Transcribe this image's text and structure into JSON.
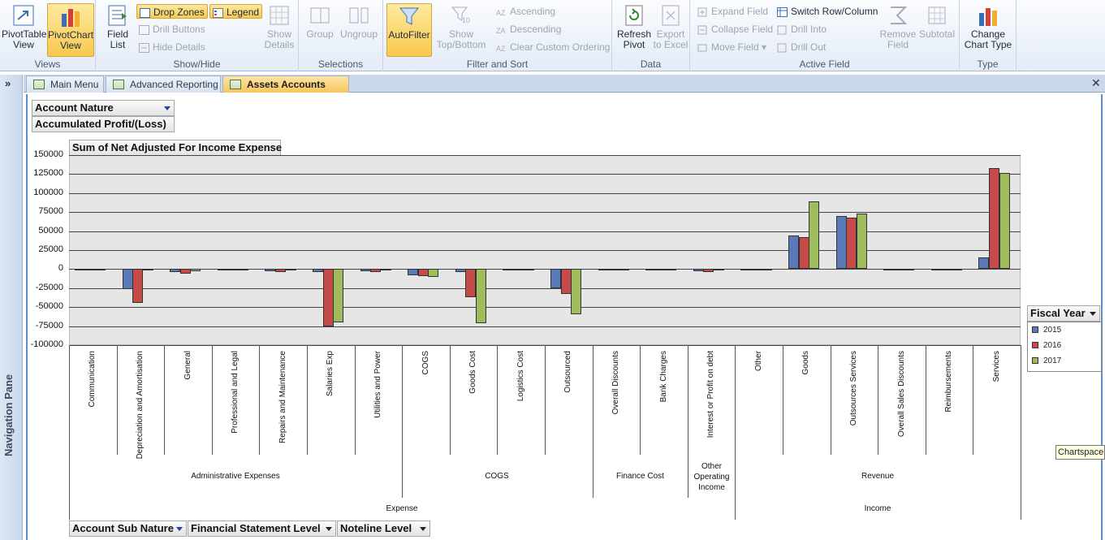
{
  "ribbon": {
    "views": {
      "label": "Views",
      "pivottable": "PivotTable View",
      "pivotchart": "PivotChart View"
    },
    "showhide": {
      "label": "Show/Hide",
      "fieldlist": "Field List",
      "dropzones": "Drop Zones",
      "legend": "Legend",
      "drillbuttons": "Drill Buttons",
      "hidedetails": "Hide Details",
      "showdetails": "Show Details"
    },
    "selections": {
      "label": "Selections",
      "group": "Group",
      "ungroup": "Ungroup"
    },
    "filtersort": {
      "label": "Filter and Sort",
      "autofilter": "AutoFilter",
      "showtopbottom": "Show Top/Bottom",
      "ascending": "Ascending",
      "descending": "Descending",
      "clearordering": "Clear Custom Ordering"
    },
    "data": {
      "label": "Data",
      "refresh": "Refresh Pivot",
      "export": "Export to Excel"
    },
    "activefield": {
      "label": "Active Field",
      "expand": "Expand Field",
      "collapse": "Collapse Field",
      "movefield": "Move Field",
      "switchrow": "Switch Row/Column",
      "drillinto": "Drill Into",
      "drillout": "Drill Out",
      "removefield": "Remove Field",
      "subtotal": "Subtotal"
    },
    "type": {
      "label": "Type",
      "changechart": "Change Chart Type"
    }
  },
  "nav": {
    "pane_label": "Navigation Pane",
    "collapse_glyph": "»",
    "close_glyph": "✕"
  },
  "tabs": [
    {
      "label": "Main Menu"
    },
    {
      "label": "Advanced Reporting"
    },
    {
      "label": "Assets Accounts Graph"
    }
  ],
  "filters": {
    "account_nature": "Account Nature",
    "accumulated": "Accumulated Profit/(Loss)",
    "data_field": "Sum of Net Adjusted For Income Expense",
    "account_sub_nature": "Account Sub Nature",
    "fs_level": "Financial Statement Level",
    "noteline_level": "Noteline Level"
  },
  "legend": {
    "title": "Fiscal Year"
  },
  "tooltip": "Chartspace",
  "colors": {
    "s2015": "#5a79b7",
    "s2016": "#c54b48",
    "s2017": "#9dbd5c"
  },
  "chart_data": {
    "type": "bar",
    "ylim": [
      -100000,
      150000
    ],
    "yticks": [
      "150000",
      "125000",
      "100000",
      "75000",
      "50000",
      "25000",
      "0",
      "-25000",
      "-50000",
      "-75000",
      "-100000"
    ],
    "categories": [
      "Communication",
      "Depreciation and Amortisation",
      "General",
      "Professional and Legal",
      "Repairs and Maintenance",
      "Salaries Exp",
      "Utilities and Power",
      "COGS",
      "Goods Cost",
      "Logistics Cost",
      "Outsourced",
      "Overall Discounts",
      "Bank Charges",
      "Interest or Profit on debt",
      "Other",
      "Goods",
      "Outsources Services",
      "Overall Sales Discounts",
      "Reimbursements",
      "Services"
    ],
    "groups": [
      {
        "label": "Administrative Expenses",
        "count": 7
      },
      {
        "label": "COGS",
        "count": 4
      },
      {
        "label": "Finance Cost",
        "count": 2
      },
      {
        "label": "Other Operating Income",
        "count": 1
      },
      {
        "label": "Revenue",
        "count": 6
      }
    ],
    "top_groups": [
      {
        "label": "Expense",
        "count": 14
      },
      {
        "label": "Income",
        "count": 6
      }
    ],
    "series": [
      {
        "name": "2015",
        "values": [
          -1000,
          -26000,
          -4000,
          -1000,
          -3000,
          -4000,
          -3000,
          -8000,
          -4000,
          0,
          -25000,
          0,
          0,
          -3000,
          0,
          44000,
          70000,
          0,
          1000,
          15000
        ]
      },
      {
        "name": "2016",
        "values": [
          -1000,
          -45000,
          -6000,
          -1000,
          -4000,
          -76000,
          -4000,
          -9000,
          -37000,
          -1000,
          -33000,
          0,
          -1000,
          -4000,
          0,
          42000,
          68000,
          0,
          1000,
          133000
        ]
      },
      {
        "name": "2017",
        "values": [
          -1000,
          0,
          -3000,
          -1000,
          -2000,
          -70000,
          -2000,
          -10000,
          -71000,
          0,
          -59000,
          0,
          0,
          -1000,
          0,
          89000,
          73000,
          0,
          1000,
          127000
        ]
      }
    ]
  }
}
